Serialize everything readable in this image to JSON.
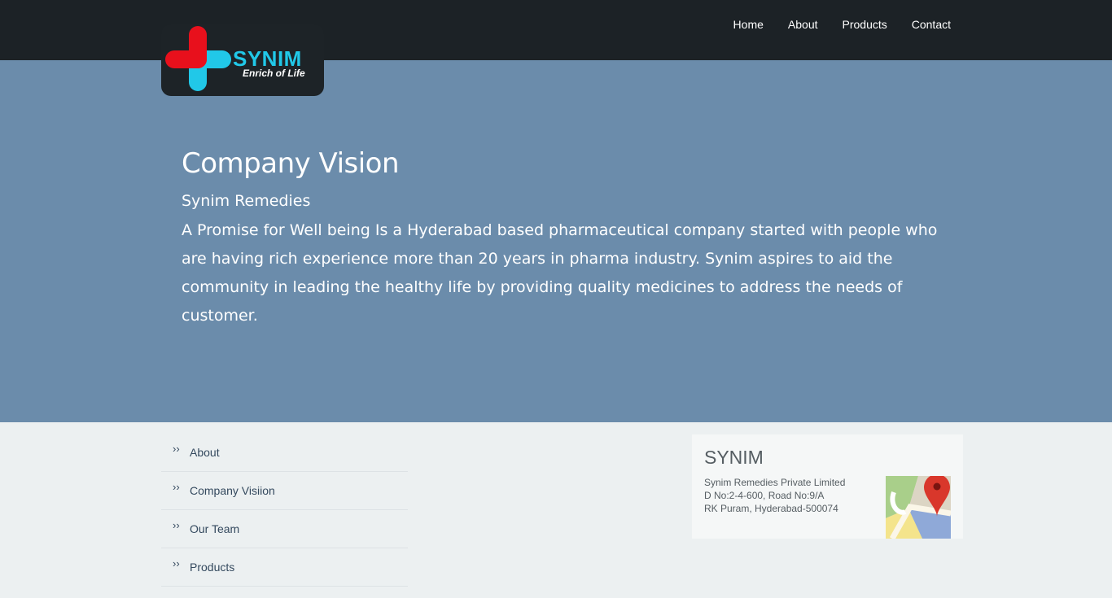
{
  "brand": {
    "name": "SYNIM",
    "tagline": "Enrich of Life",
    "colors": {
      "cross_red": "#e8101c",
      "cross_cyan": "#21c8e8"
    }
  },
  "nav": {
    "items": [
      {
        "label": "Home"
      },
      {
        "label": "About"
      },
      {
        "label": "Products"
      },
      {
        "label": "Contact"
      }
    ]
  },
  "hero": {
    "title": "Company Vision",
    "subtitle": "Synim Remedies",
    "body": "A Promise for Well being Is a Hyderabad based pharmaceutical company started with people who are having rich experience more than 20 years in pharma industry. Synim aspires to aid the community in leading the healthy life by providing quality medicines to address the needs of customer."
  },
  "footer": {
    "links": [
      {
        "icon": "double-chevron-right-icon",
        "label": "About"
      },
      {
        "icon": "double-chevron-right-icon",
        "label": "Company Visiion"
      },
      {
        "icon": "double-chevron-right-icon",
        "label": "Our Team"
      },
      {
        "icon": "double-chevron-right-icon",
        "label": "Products"
      }
    ],
    "contact": {
      "title": "SYNIM",
      "address_lines": [
        "Synim Remedies Private Limited",
        "D No:2-4-600, Road No:9/A",
        "RK Puram, Hyderabad-500074"
      ],
      "map_icon": "google-maps-icon"
    }
  },
  "colors": {
    "topbar": "#1c2226",
    "hero_bg": "#6b8cab",
    "footer_bg": "#ecf0f1"
  }
}
